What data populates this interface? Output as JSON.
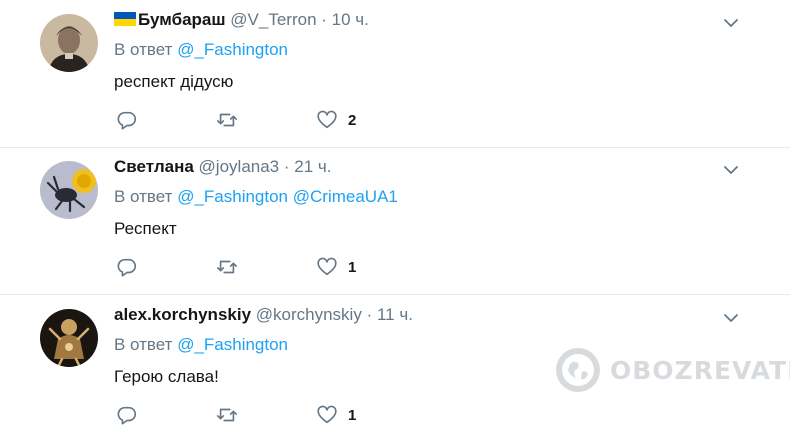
{
  "tweets": [
    {
      "name": "Бумбараш",
      "handle": "@V_Terron",
      "dot": "·",
      "time": "10 ч.",
      "reply_prefix": "В ответ",
      "mentions": [
        "@_Fashington"
      ],
      "text": "респект дідусю",
      "reply_count": "",
      "retweet_count": "",
      "like_count": "2",
      "flag_colors": [
        "#0057b7",
        "#ffd700"
      ],
      "avatar": "vintage-portrait-avatar"
    },
    {
      "name": "Светлана",
      "handle": "@joylana3",
      "dot": "·",
      "time": "21 ч.",
      "reply_prefix": "В ответ",
      "mentions": [
        "@_Fashington",
        "@CrimeaUA1"
      ],
      "text": "Респект",
      "reply_count": "",
      "retweet_count": "",
      "like_count": "1",
      "avatar": "beetle-dandelion-avatar"
    },
    {
      "name": "alex.korchynskiy",
      "handle": "@korchynskiy",
      "dot": "·",
      "time": "11 ч.",
      "reply_prefix": "В ответ",
      "mentions": [
        "@_Fashington"
      ],
      "text": "Герою слава!",
      "reply_count": "",
      "retweet_count": "",
      "like_count": "1",
      "avatar": "ornate-figure-avatar"
    }
  ],
  "icons": {
    "reply": "reply-icon",
    "retweet": "retweet-icon",
    "like": "heart-icon",
    "more": "chevron-down-icon"
  },
  "watermark": {
    "text": "OBOZREVATEL",
    "logo": "globe-logo"
  },
  "colors": {
    "link": "#1da1f2",
    "muted": "#657786",
    "text": "#14171a",
    "divider": "#e6ecf0"
  }
}
